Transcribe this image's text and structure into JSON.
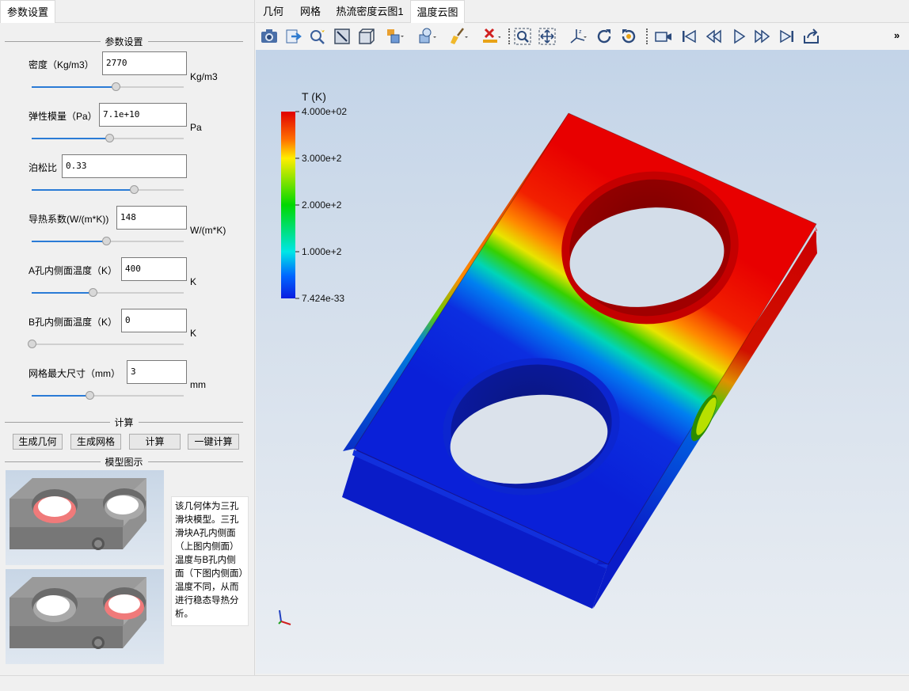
{
  "left_tab": "参数设置",
  "params_group_title": "参数设置",
  "params": [
    {
      "label": "密度（Kg/m3）",
      "value": "2770",
      "unit": "Kg/m3",
      "slider": 0.55
    },
    {
      "label": "弹性模量（Pa）",
      "value": "7.1e+10",
      "unit": "Pa",
      "slider": 0.51
    },
    {
      "label": "泊松比",
      "value": "0.33",
      "unit": "",
      "slider": 0.67
    },
    {
      "label": "导热系数(W/(m*K))",
      "value": "148",
      "unit": "W/(m*K)",
      "slider": 0.49
    },
    {
      "label": "A孔内侧面温度（K）",
      "value": "400",
      "unit": "K",
      "slider": 0.4
    },
    {
      "label": "B孔内侧面温度（K）",
      "value": "0",
      "unit": "K",
      "slider": 0.0
    },
    {
      "label": "网格最大尺寸（mm）",
      "value": "3",
      "unit": "mm",
      "slider": 0.38
    }
  ],
  "compute_group_title": "计算",
  "buttons": [
    "生成几何",
    "生成网格",
    "计算",
    "一键计算"
  ],
  "model_group_title": "模型图示",
  "description": "该几何体为三孔滑块模型。三孔滑块A孔内侧面（上图内侧面）温度与B孔内侧面（下图内侧面）温度不同，从而进行稳态导热分析。",
  "tabs": [
    "几何",
    "网格",
    "热流密度云图1",
    "温度云图"
  ],
  "active_tab": 3,
  "toolbar_icons": [
    "camera-icon",
    "export-icon",
    "query-icon",
    "view-fit-icon",
    "box-view-icon",
    "display-mode-icon",
    "render-mode-icon",
    "clear-brush-icon",
    "delete-mark-icon",
    "zoom-window-icon",
    "pan-icon",
    "axis-orient-icon",
    "rotate-cw-icon",
    "rotate-ccw-icon",
    "record-icon",
    "first-frame-icon",
    "prev-frame-icon",
    "play-icon",
    "next-frame-icon",
    "last-frame-icon",
    "share-icon"
  ],
  "overflow_label": "»",
  "legend": {
    "title": "T (K)",
    "ticks": [
      "4.000e+02",
      "3.000e+2",
      "2.000e+2",
      "1.000e+2",
      "7.424e-33"
    ]
  },
  "colors": {
    "hot": "#e80000",
    "cold": "#0a22d8",
    "accent": "#2a7bd6"
  }
}
